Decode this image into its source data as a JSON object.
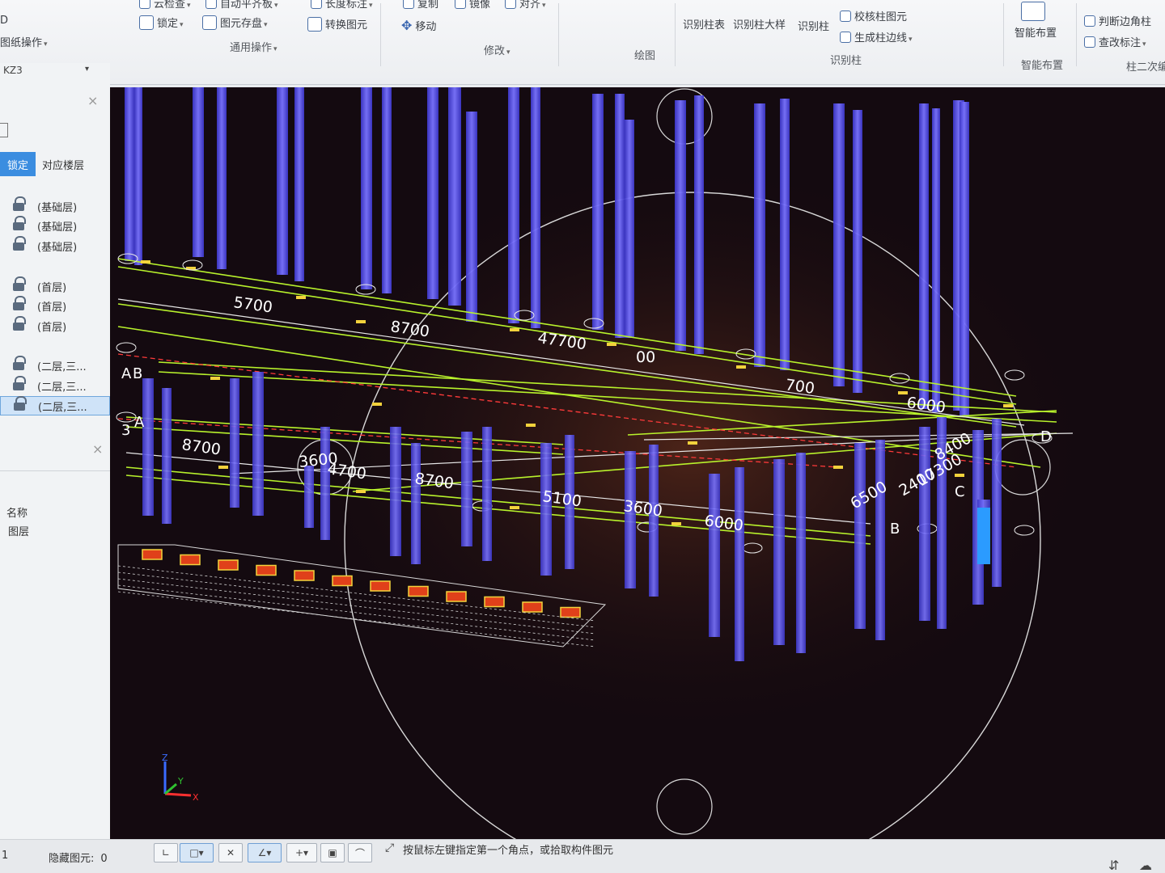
{
  "ribbon": {
    "top_row": [
      {
        "label": "云检查",
        "icon": "check-icon"
      },
      {
        "label": "自动平齐板",
        "icon": "align-slab-icon"
      },
      {
        "label": "长度标注",
        "icon": "dimension-icon"
      },
      {
        "label": "复制",
        "icon": "copy-icon"
      },
      {
        "label": "镜像",
        "icon": "mirror-icon"
      },
      {
        "label": "对齐",
        "icon": "align-icon"
      }
    ],
    "drawing_ops_label": "图纸操作",
    "lock_label": "锁定",
    "save_element_label": "图元存盘",
    "convert_element_label": "转换图元",
    "move_label": "移动",
    "common_ops_group": "通用操作",
    "modify_group": "修改",
    "draw_group": "绘图",
    "identify_col_table": "识别柱表",
    "identify_col_large": "识别柱大样",
    "identify_col": "识别柱",
    "verify_col": "校核柱图元",
    "gen_col_edge": "生成柱边线",
    "identify_group": "识别柱",
    "smart_layout_btn": "智能布置",
    "smart_layout_group": "智能布置",
    "judge_edge_col": "判断边角柱",
    "query_label": "查改标注",
    "col_secondary": "柱二次编辑",
    "left_partial": "D"
  },
  "left_panel": {
    "combo_value": "KZ3",
    "lock_tab": "锁定",
    "floor_tab": "对应楼层",
    "floors": [
      "(基础层)",
      "(基础层)",
      "(基础层)",
      "(首层)",
      "(首层)",
      "(首层)",
      "(二层,三...",
      "(二层,三...",
      "(二层,三..."
    ],
    "prop_name": "名称",
    "prop_layer": "图层"
  },
  "viewport": {
    "dims": [
      "5700",
      "8700",
      "47700",
      "00",
      "700",
      "6000",
      "8700",
      "3600",
      "4700",
      "8700",
      "5100",
      "3600",
      "6000",
      "6500",
      "2400",
      "17300",
      "8400"
    ],
    "axis_letters": [
      "D",
      "C",
      "B",
      "A",
      "B",
      "A",
      "3"
    ],
    "axis_labels": {
      "z": "Z",
      "y": "Y",
      "x": "X"
    },
    "colors": {
      "column": "#5b55e6",
      "grid_line": "#b8f22c",
      "dim_line": "#e8e8e8",
      "axis_red": "#ff3a3a"
    }
  },
  "status_bar": {
    "hidden_count_label": "隐藏图元:",
    "hidden_count": "0",
    "prompt": "按鼠标左键指定第一个角点，或拾取构件图元",
    "left_marker": "1"
  }
}
